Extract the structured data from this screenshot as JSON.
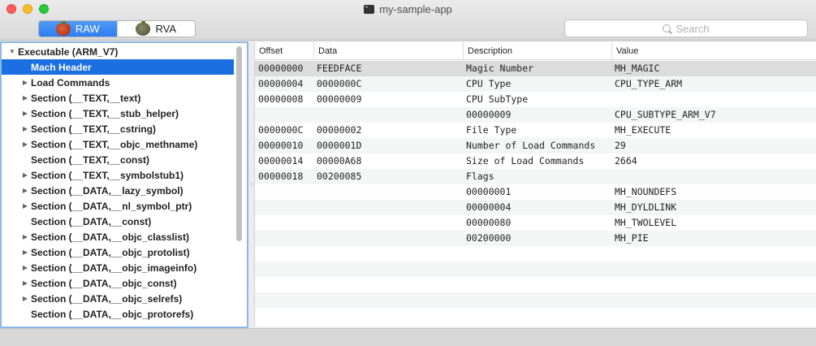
{
  "window": {
    "title": "my-sample-app"
  },
  "toolbar": {
    "segments": [
      {
        "label": "RAW",
        "icon": "apple-icon",
        "active": true
      },
      {
        "label": "RVA",
        "icon": "apple-icon",
        "active": false
      }
    ],
    "search_placeholder": "Search"
  },
  "tree": {
    "items": [
      {
        "label": "Executable  (ARM_V7)",
        "expand": "open",
        "indent": 0,
        "selected": false
      },
      {
        "label": "Mach Header",
        "expand": "",
        "indent": 1,
        "selected": true
      },
      {
        "label": "Load Commands",
        "expand": "closed",
        "indent": 1,
        "selected": false
      },
      {
        "label": "Section (__TEXT,__text)",
        "expand": "closed",
        "indent": 1,
        "selected": false
      },
      {
        "label": "Section (__TEXT,__stub_helper)",
        "expand": "closed",
        "indent": 1,
        "selected": false
      },
      {
        "label": "Section (__TEXT,__cstring)",
        "expand": "closed",
        "indent": 1,
        "selected": false
      },
      {
        "label": "Section (__TEXT,__objc_methname)",
        "expand": "closed",
        "indent": 1,
        "selected": false
      },
      {
        "label": "Section (__TEXT,__const)",
        "expand": "",
        "indent": 1,
        "selected": false
      },
      {
        "label": "Section (__TEXT,__symbolstub1)",
        "expand": "closed",
        "indent": 1,
        "selected": false
      },
      {
        "label": "Section (__DATA,__lazy_symbol)",
        "expand": "closed",
        "indent": 1,
        "selected": false
      },
      {
        "label": "Section (__DATA,__nl_symbol_ptr)",
        "expand": "closed",
        "indent": 1,
        "selected": false
      },
      {
        "label": "Section (__DATA,__const)",
        "expand": "",
        "indent": 1,
        "selected": false
      },
      {
        "label": "Section (__DATA,__objc_classlist)",
        "expand": "closed",
        "indent": 1,
        "selected": false
      },
      {
        "label": "Section (__DATA,__objc_protolist)",
        "expand": "closed",
        "indent": 1,
        "selected": false
      },
      {
        "label": "Section (__DATA,__objc_imageinfo)",
        "expand": "closed",
        "indent": 1,
        "selected": false
      },
      {
        "label": "Section (__DATA,__objc_const)",
        "expand": "closed",
        "indent": 1,
        "selected": false
      },
      {
        "label": "Section (__DATA,__objc_selrefs)",
        "expand": "closed",
        "indent": 1,
        "selected": false
      },
      {
        "label": "Section (__DATA,__objc_protorefs)",
        "expand": "",
        "indent": 1,
        "selected": false
      }
    ]
  },
  "table": {
    "columns": [
      "Offset",
      "Data",
      "Description",
      "Value"
    ],
    "rows": [
      [
        "00000000",
        "FEEDFACE",
        "Magic Number",
        "MH_MAGIC"
      ],
      [
        "00000004",
        "0000000C",
        "CPU Type",
        "CPU_TYPE_ARM"
      ],
      [
        "00000008",
        "00000009",
        "CPU SubType",
        ""
      ],
      [
        "",
        "",
        "00000009",
        "CPU_SUBTYPE_ARM_V7"
      ],
      [
        "0000000C",
        "00000002",
        "File Type",
        "MH_EXECUTE"
      ],
      [
        "00000010",
        "0000001D",
        "Number of Load Commands",
        "29"
      ],
      [
        "00000014",
        "00000A68",
        "Size of Load Commands",
        "2664"
      ],
      [
        "00000018",
        "00200085",
        "Flags",
        ""
      ],
      [
        "",
        "",
        "00000001",
        "MH_NOUNDEFS"
      ],
      [
        "",
        "",
        "00000004",
        "MH_DYLDLINK"
      ],
      [
        "",
        "",
        "00000080",
        "MH_TWOLEVEL"
      ],
      [
        "",
        "",
        "00200000",
        "MH_PIE"
      ]
    ],
    "selected_row": 0
  },
  "colors": {
    "selection": "#1b6fe0",
    "focus_ring": "#8db7e8",
    "segment_active": "#2d7ef0"
  }
}
